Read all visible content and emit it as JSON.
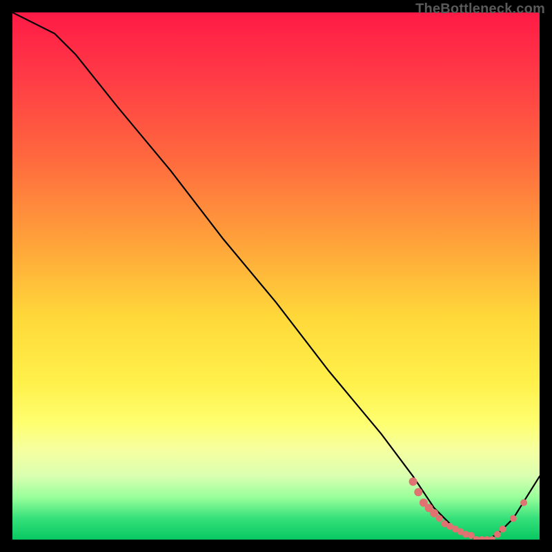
{
  "watermark": "TheBottleneck.com",
  "chart_data": {
    "type": "line",
    "title": "",
    "xlabel": "",
    "ylabel": "",
    "xlim": [
      0,
      100
    ],
    "ylim": [
      0,
      100
    ],
    "series": [
      {
        "name": "curve",
        "x": [
          0,
          8,
          12,
          20,
          30,
          40,
          50,
          60,
          70,
          76,
          80,
          84,
          88,
          90,
          92,
          95,
          100
        ],
        "values": [
          100,
          96,
          92,
          82,
          70,
          57,
          45,
          32,
          20,
          12,
          6,
          2,
          0,
          0,
          1,
          4,
          12
        ]
      }
    ],
    "markers": {
      "name": "dots",
      "color": "#e07272",
      "x": [
        76,
        77,
        78,
        79,
        80,
        81,
        82,
        83,
        84,
        85,
        86,
        87,
        88,
        89,
        90,
        91,
        92,
        93,
        95,
        97
      ],
      "values": [
        11,
        9,
        7,
        6,
        5,
        4,
        3,
        2.5,
        2,
        1.5,
        1,
        0.8,
        0,
        0,
        0,
        0,
        1,
        2,
        4,
        7
      ]
    }
  }
}
